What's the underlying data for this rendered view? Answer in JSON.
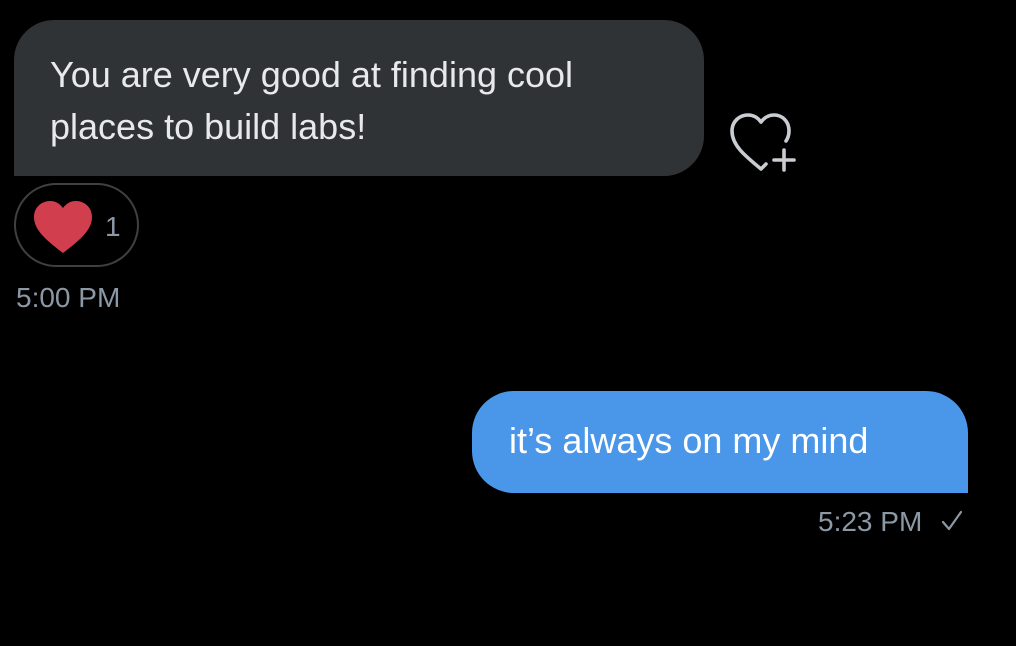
{
  "conversation": {
    "received_message": {
      "text": "You are very good at finding cool\nplaces to build labs!",
      "timestamp": "5:00 PM",
      "reaction": {
        "icon": "heart-icon",
        "color": "#d13f4f",
        "count": "1"
      }
    },
    "add_reaction_icon": "heart-plus-icon",
    "sent_message": {
      "text": "it’s always on my mind",
      "timestamp": "5:23 PM",
      "status_icon": "check-icon"
    }
  },
  "colors": {
    "background": "#000000",
    "received_bubble": "#2f3336",
    "sent_bubble": "#4a96e8",
    "muted_text": "#8b98a5"
  }
}
